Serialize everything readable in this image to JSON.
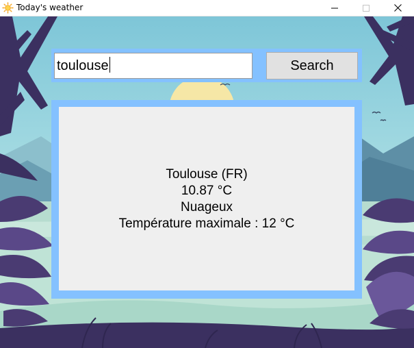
{
  "window": {
    "title": "Today's weather",
    "app_icon": "sun-icon",
    "controls": [
      "minimize-icon",
      "maximize-icon",
      "close-icon"
    ]
  },
  "search": {
    "value": "toulouse",
    "button_label": "Search"
  },
  "result": {
    "city": "Toulouse (FR)",
    "temperature": "10.87 °C",
    "condition": "Nuageux",
    "max_temperature": "Température maximale : 12 °C"
  },
  "colors": {
    "frame": "#84c1ff",
    "panel": "#efefef",
    "button": "#e1e1e1",
    "sky": "#8fd0dc",
    "sun": "#f6e7a6",
    "mountains": "#5e8fa6",
    "foliage": "#3b3060",
    "ground": "#bfe3d6"
  }
}
